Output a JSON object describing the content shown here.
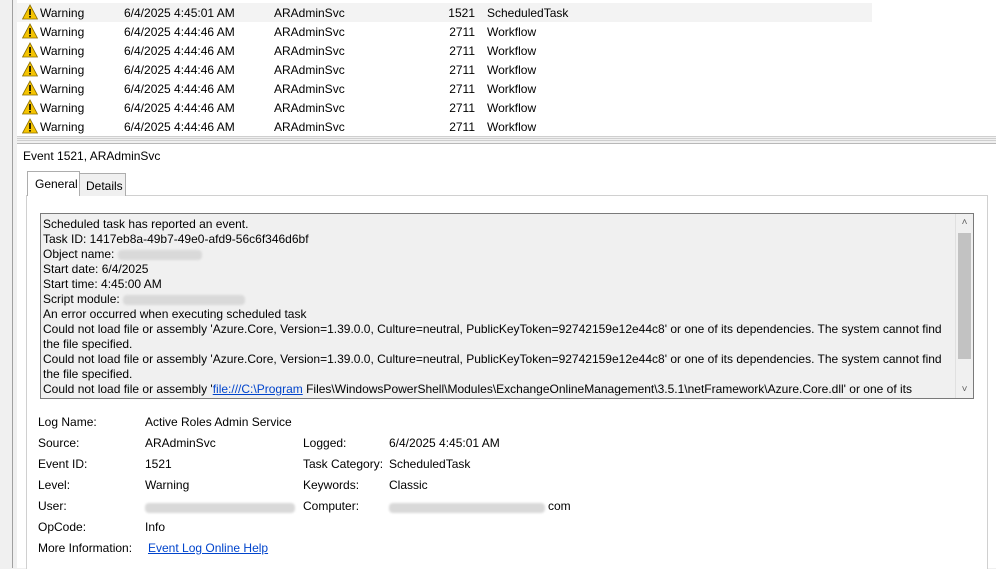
{
  "events": [
    {
      "level": "Warning",
      "date": "6/4/2025 4:45:01 AM",
      "source": "ARAdminSvc",
      "id": "1521",
      "category": "ScheduledTask",
      "selected": true
    },
    {
      "level": "Warning",
      "date": "6/4/2025 4:44:46 AM",
      "source": "ARAdminSvc",
      "id": "2711",
      "category": "Workflow"
    },
    {
      "level": "Warning",
      "date": "6/4/2025 4:44:46 AM",
      "source": "ARAdminSvc",
      "id": "2711",
      "category": "Workflow"
    },
    {
      "level": "Warning",
      "date": "6/4/2025 4:44:46 AM",
      "source": "ARAdminSvc",
      "id": "2711",
      "category": "Workflow"
    },
    {
      "level": "Warning",
      "date": "6/4/2025 4:44:46 AM",
      "source": "ARAdminSvc",
      "id": "2711",
      "category": "Workflow"
    },
    {
      "level": "Warning",
      "date": "6/4/2025 4:44:46 AM",
      "source": "ARAdminSvc",
      "id": "2711",
      "category": "Workflow"
    },
    {
      "level": "Warning",
      "date": "6/4/2025 4:44:46 AM",
      "source": "ARAdminSvc",
      "id": "2711",
      "category": "Workflow"
    }
  ],
  "detail": {
    "header": "Event 1521, ARAdminSvc",
    "tabs": {
      "general": "General",
      "details": "Details"
    },
    "description": {
      "line1": "Scheduled task has reported an event.",
      "line2": "Task ID: 1417eb8a-49b7-49e0-afd9-56c6f346d6bf",
      "object_label": "Object name:",
      "line4": "Start date: 6/4/2025",
      "line5": "Start time: 4:45:00 AM",
      "script_label": "Script module:",
      "line7": "An error occurred when executing scheduled task",
      "line8": "Could not load file or assembly 'Azure.Core, Version=1.39.0.0, Culture=neutral, PublicKeyToken=92742159e12e44c8' or one of its dependencies. The system cannot find the file specified.",
      "line9": "Could not load file or assembly 'Azure.Core, Version=1.39.0.0, Culture=neutral, PublicKeyToken=92742159e12e44c8' or one of its dependencies. The system cannot find the file specified.",
      "line10_pre": "Could not load file or assembly '",
      "line10_link": "file:///C:\\Program",
      "line10_post": " Files\\WindowsPowerShell\\Modules\\ExchangeOnlineManagement\\3.5.1\\netFramework\\Azure.Core.dll' or one of its"
    },
    "fields": {
      "log_name_label": "Log Name:",
      "log_name": "Active Roles Admin Service",
      "source_label": "Source:",
      "source": "ARAdminSvc",
      "logged_label": "Logged:",
      "logged": "6/4/2025 4:45:01 AM",
      "event_id_label": "Event ID:",
      "event_id": "1521",
      "task_category_label": "Task Category:",
      "task_category": "ScheduledTask",
      "level_label": "Level:",
      "level": "Warning",
      "keywords_label": "Keywords:",
      "keywords": "Classic",
      "user_label": "User:",
      "computer_label": "Computer:",
      "computer_suffix": "com",
      "opcode_label": "OpCode:",
      "opcode": "Info",
      "more_info_label": "More Information:",
      "more_info_link": "Event Log Online Help"
    }
  },
  "colors": {
    "warning_icon": "#f5c400",
    "link": "#0044cc",
    "selected_row": "#f3f3f3"
  }
}
